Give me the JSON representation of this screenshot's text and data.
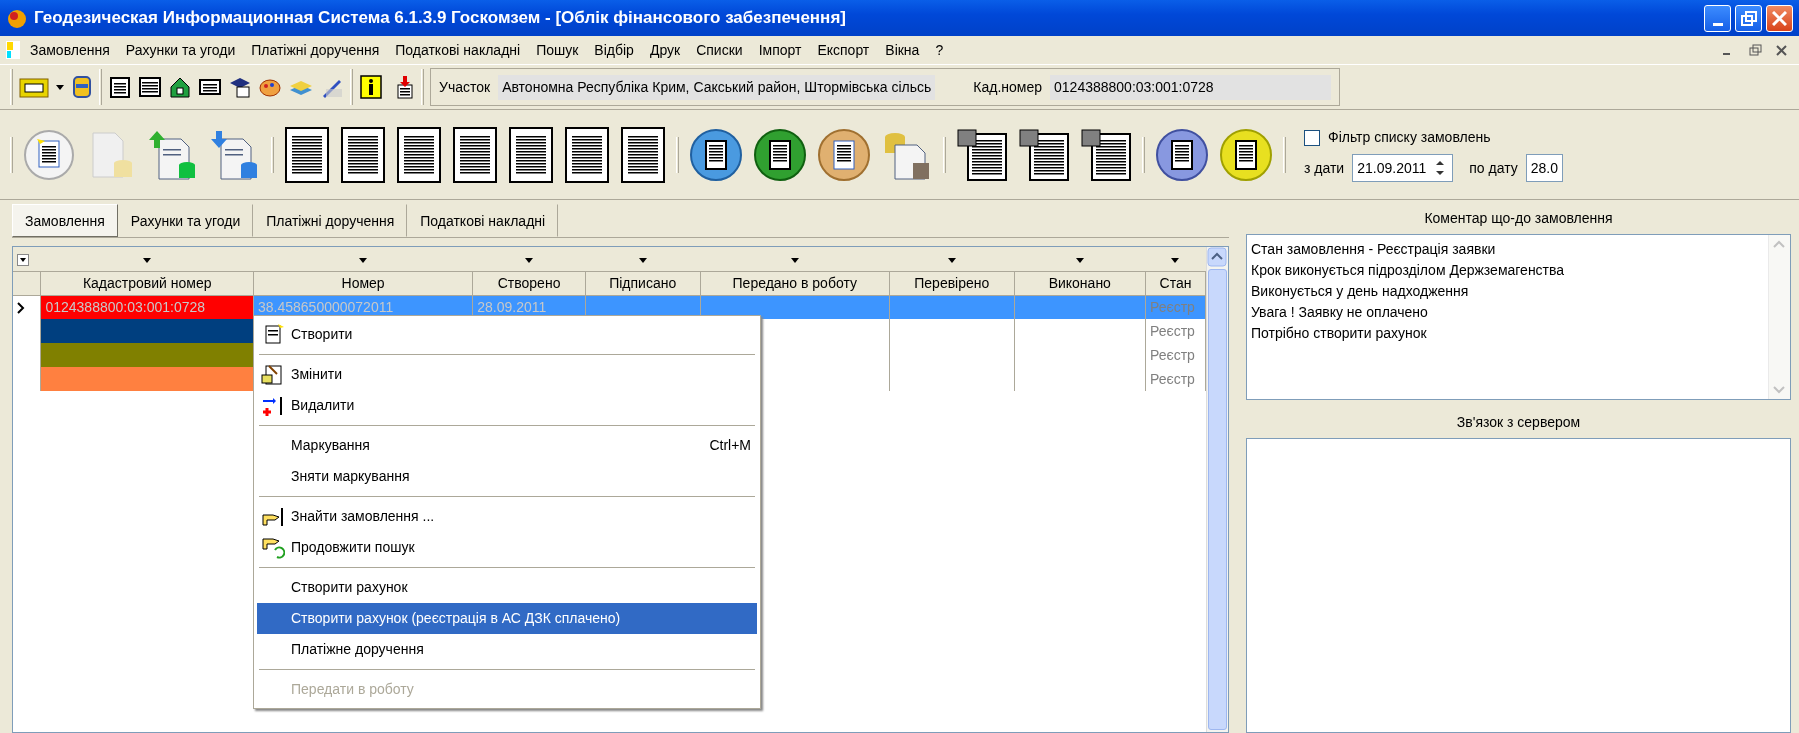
{
  "window": {
    "title": "Геодезическая Информационная Система 6.1.3.9 Госкомзем - [Облік фінансового забезпечення]"
  },
  "menu_bar": {
    "items": [
      "Замовлення",
      "Рахунки та угоди",
      "Платіжні доручення",
      "Податкові накладні",
      "Пошук",
      "Відбір",
      "Друк",
      "Списки",
      "Імпорт",
      "Експорт",
      "Вікна",
      "?"
    ]
  },
  "toolbar": {
    "fields": [
      {
        "label": "Участок",
        "value": "Автономна Республіка Крим, Сакський район, Штормівська сільсь"
      },
      {
        "label": "Кад.номер",
        "value": "0124388800:03:001:0728"
      }
    ]
  },
  "filter": {
    "label": "Фільтр списку замовлень",
    "checked": false,
    "from_label": "з дати",
    "from_value": "21.09.2011",
    "to_label": "по дату",
    "to_value": "28.0"
  },
  "tabs": [
    {
      "label": "Замовлення",
      "selected": true
    },
    {
      "label": "Рахунки та угоди",
      "selected": false
    },
    {
      "label": "Платіжні доручення",
      "selected": false
    },
    {
      "label": "Податкові накладні",
      "selected": false
    }
  ],
  "table": {
    "columns": [
      "Кадастровий номер",
      "Номер",
      "Створено",
      "Підписано",
      "Передано в роботу",
      "Перевірено",
      "Виконано",
      "Стан"
    ],
    "rows": [
      {
        "selected": true,
        "color": "#ff0000",
        "cells": [
          "0124388800:03:001:0728",
          "38.458650000072011",
          "28.09.2011",
          "",
          "",
          "",
          "",
          "Реєстр"
        ]
      },
      {
        "selected": false,
        "color": "#003f7f",
        "cells": [
          "",
          "",
          "",
          "",
          "",
          "",
          "",
          "Реєстр"
        ]
      },
      {
        "selected": false,
        "color": "#808000",
        "cells": [
          "",
          "",
          "",
          "",
          "",
          "",
          "",
          "Реєстр"
        ]
      },
      {
        "selected": false,
        "color": "#ff8040",
        "cells": [
          "",
          "",
          "",
          "",
          "",
          "",
          "",
          "Реєстр"
        ]
      }
    ]
  },
  "context_menu": {
    "items": [
      {
        "kind": "item",
        "label": "Створити",
        "selected": false,
        "disabled": false
      },
      {
        "kind": "separator"
      },
      {
        "kind": "item",
        "label": "Змінити",
        "selected": false,
        "disabled": false
      },
      {
        "kind": "item",
        "label": "Видалити",
        "selected": false,
        "disabled": false
      },
      {
        "kind": "separator"
      },
      {
        "kind": "item",
        "label": "Маркування",
        "shortcut": "Ctrl+M",
        "selected": false,
        "disabled": false
      },
      {
        "kind": "item",
        "label": "Зняти маркування",
        "selected": false,
        "disabled": false
      },
      {
        "kind": "separator"
      },
      {
        "kind": "item",
        "label": "Знайти замовлення ...",
        "selected": false,
        "disabled": false
      },
      {
        "kind": "item",
        "label": "Продовжити пошук",
        "selected": false,
        "disabled": false
      },
      {
        "kind": "separator"
      },
      {
        "kind": "item",
        "label": "Створити рахунок",
        "selected": false,
        "disabled": false
      },
      {
        "kind": "item",
        "label": "Створити рахунок (реєстрація в АС ДЗК сплачено)",
        "selected": true,
        "disabled": false
      },
      {
        "kind": "item",
        "label": "Платіжне доручення",
        "selected": false,
        "disabled": false
      },
      {
        "kind": "separator"
      },
      {
        "kind": "item",
        "label": "Передати в роботу",
        "selected": false,
        "disabled": true
      }
    ]
  },
  "comment_panel": {
    "title": "Коментар що-до замовлення",
    "lines": [
      "Стан замовлення - Реєстрація заявки",
      "Крок виконується підрозділом Держземагенства",
      "Виконується у день надходження",
      "Увага ! Заявку не оплачено",
      "Потрібно створити рахунок"
    ]
  },
  "server_panel": {
    "title": "Зв'язок з сервером"
  }
}
